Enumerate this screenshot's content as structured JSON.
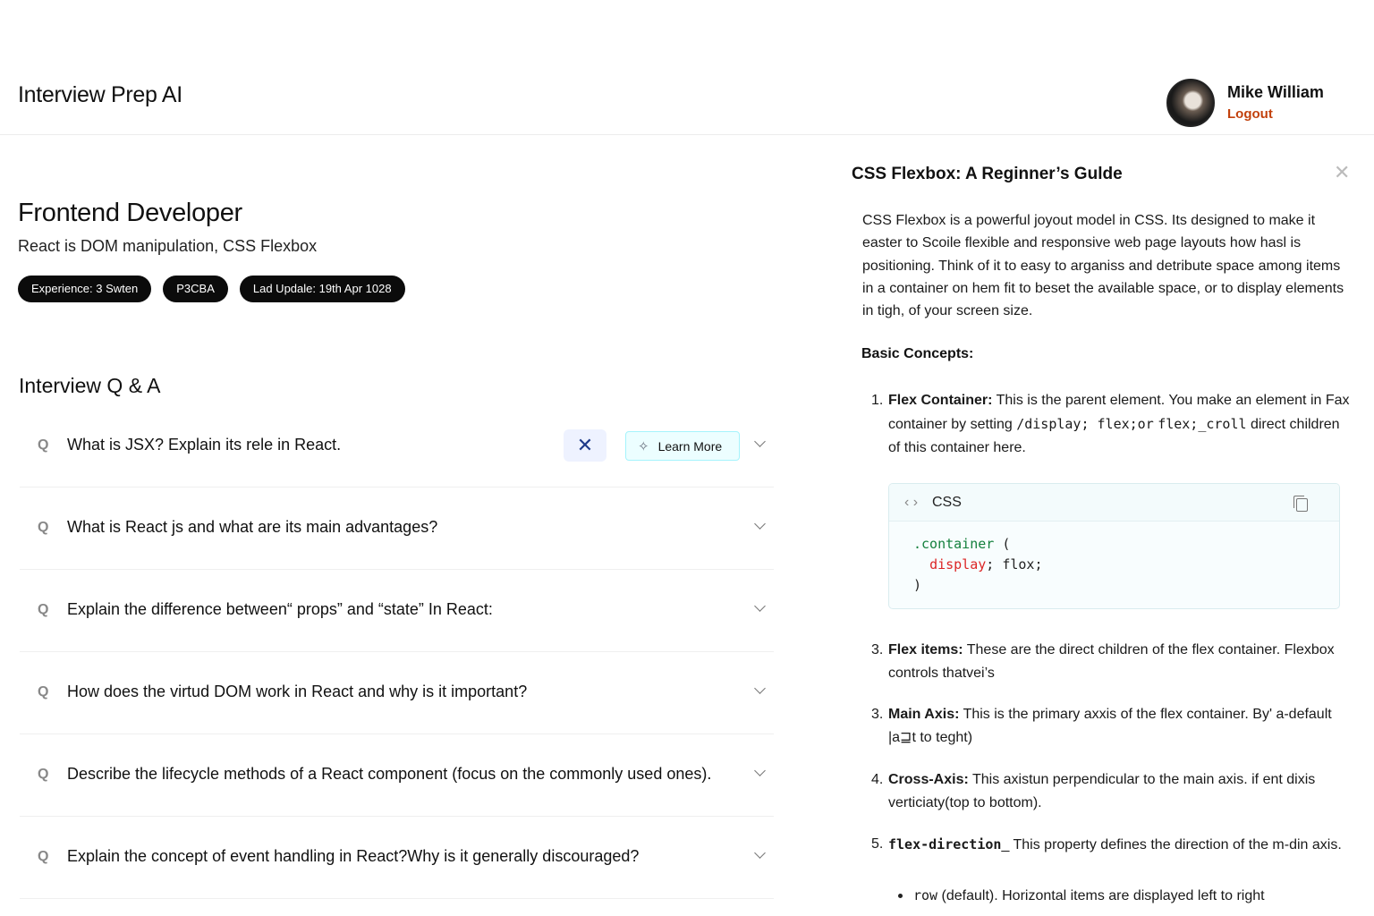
{
  "header": {
    "app_title": "Interview Prep AI",
    "user_name": "Mike William",
    "logout_label": "Logout"
  },
  "session": {
    "role": "Frontend Developer",
    "topics": "React is DOM manipulation, CSS Flexbox",
    "badges": [
      "Experience: 3 Swten",
      "P3CBA",
      "Lad Updale: 19th Apr 1028"
    ]
  },
  "qa": {
    "title": "Interview Q & A",
    "pin_icon": "✕",
    "learn_more_label": "Learn More",
    "questions": [
      "What is JSX? Explain its rele in React.",
      "What is React js and what are its main advantages?",
      "Explain the difference between“ props” and “state” In React:",
      "How does the virtud DOM work in React and why is it important?",
      "Describe the lifecycle methods of a React component (focus on the commonly used ones).",
      "Explain the concept of event handling in React?Why is it generally discouraged?"
    ]
  },
  "drawer": {
    "title": "CSS Flexbox: A Reginner’s Gulde",
    "intro": "CSS Flexbox is a powerful joyout model in CSS. Its designed to make it easter to Scoile flexible and responsive web page layouts how hasl is positioning. Think of it to easy to arganiss and detribute space among items in a container on hem fit to beset the available space, or to display elements in tigh, of your screen size.",
    "section_heading": "Basic Concepts:",
    "item1": {
      "num": "1.",
      "term": "Flex Container:",
      "text_a": " This is the parent element. You make an element in Fax container by setting ",
      "code_a": "/display; flex;",
      "text_b": "or",
      "code_b": "flex;_croll",
      "text_c": " direct children of this container here."
    },
    "code_block": {
      "language": "CSS",
      "selector": ".container",
      "open_brace": " (",
      "property": "display",
      "value": "; flox;",
      "close_brace": ")"
    },
    "item2": {
      "num": "3.",
      "term": "Flex items:",
      "text": " These are the direct children of the flex container. Flexbox controls thatvei’s"
    },
    "item3": {
      "num": "3.",
      "term": "Main Axis:",
      "text": " This is the primary axxis of the flex container. By' a-default |a⊒t to teght)"
    },
    "item4": {
      "num": "4.",
      "term": "Cross-Axis:",
      "text": " This axistun perpendicular to the main axis. if ent dixis verticiaty(top to bottom)."
    },
    "item5": {
      "num": "5.",
      "code": "flex-direction",
      "text": "_ This property defines the direction of the m-din axis."
    },
    "sub_bullet": {
      "code": "row",
      "text": " (default). Horizontal items are displayed left to right"
    }
  }
}
